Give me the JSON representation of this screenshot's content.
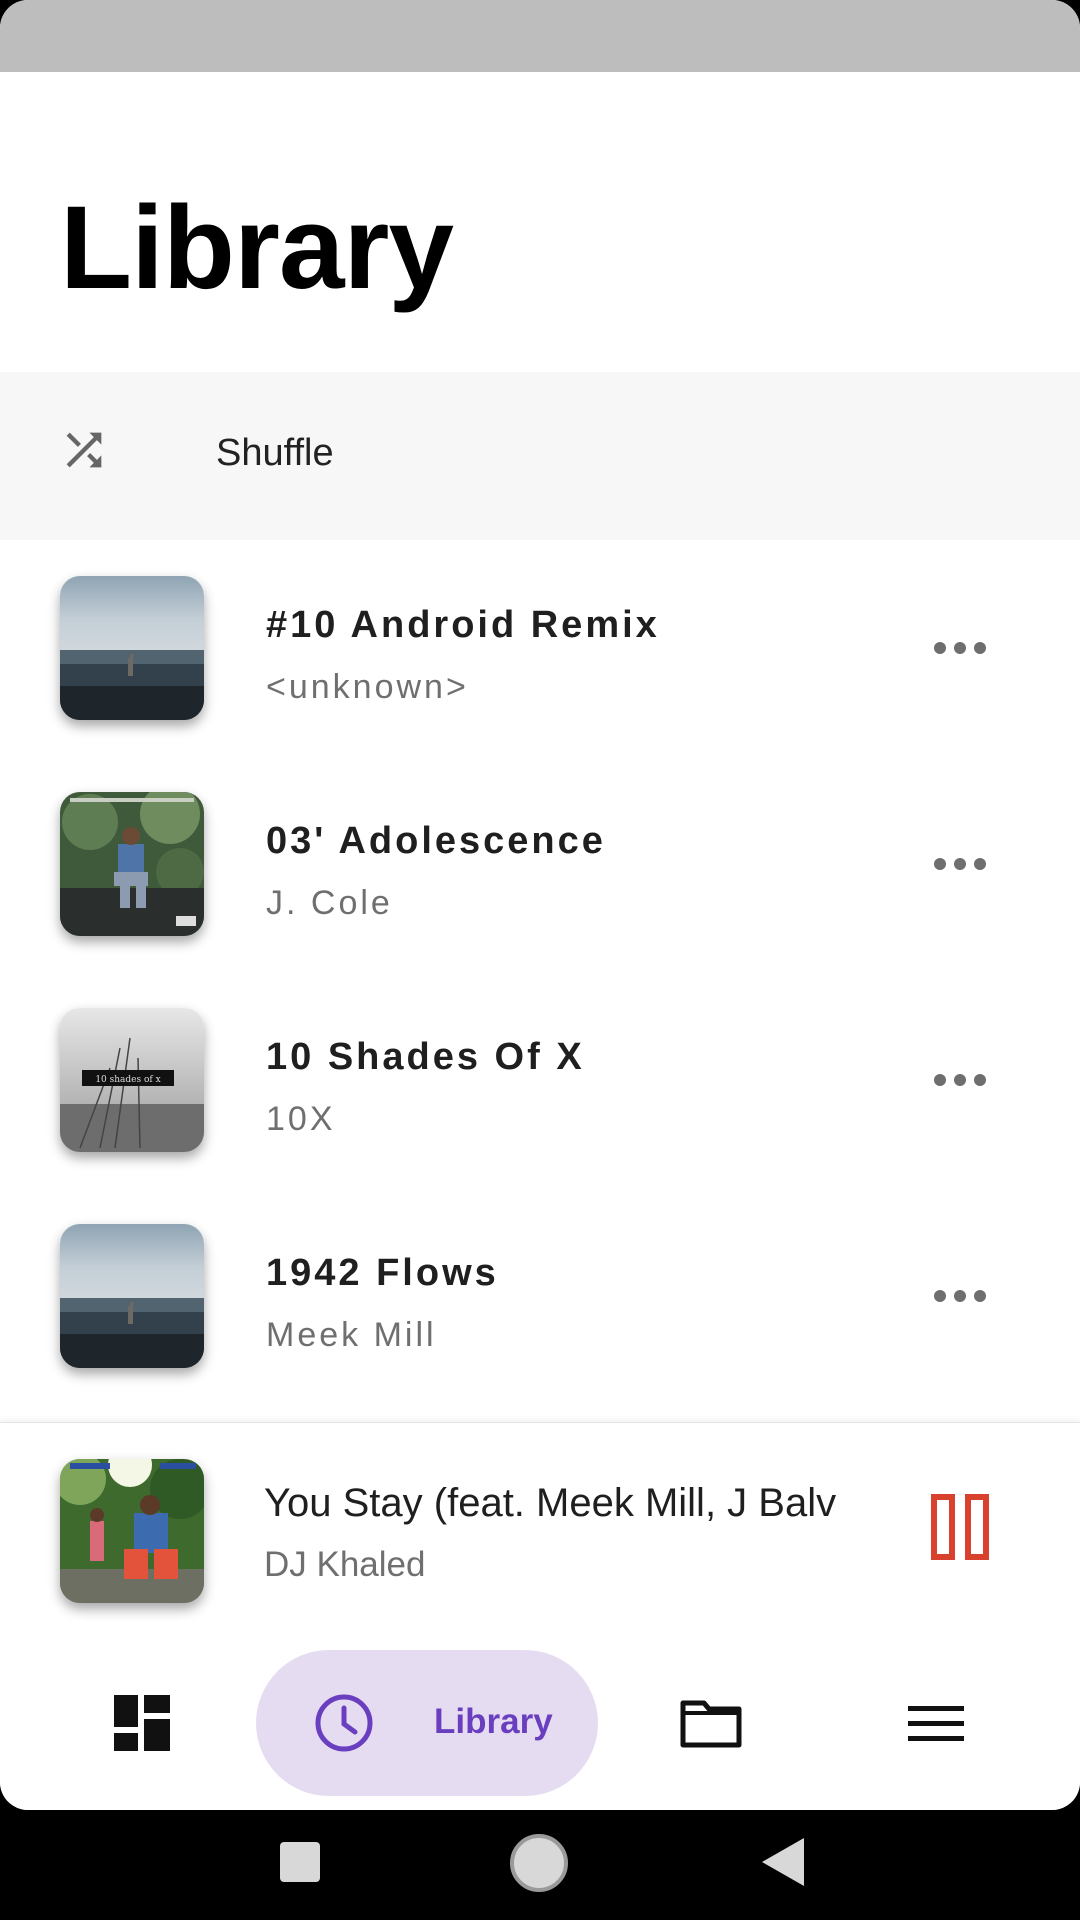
{
  "header": {
    "title": "Library"
  },
  "shuffle": {
    "label": "Shuffle",
    "icon": "shuffle-icon"
  },
  "tracks": [
    {
      "title": "#10 Android Remix",
      "artist": "<unknown>"
    },
    {
      "title": "03' Adolescence",
      "artist": "J. Cole"
    },
    {
      "title": "10 Shades Of X",
      "artist": "10X"
    },
    {
      "title": "1942 Flows",
      "artist": "Meek Mill"
    }
  ],
  "album_art_text": "10 shades of x",
  "now_playing": {
    "title": "You Stay (feat. Meek Mill, J Balv",
    "artist": "DJ Khaled",
    "state_icon": "pause-icon"
  },
  "bottom_nav": {
    "items": [
      {
        "icon": "dashboard-icon"
      },
      {
        "icon": "clock-icon",
        "label": "Library",
        "selected": true
      },
      {
        "icon": "folder-icon"
      },
      {
        "icon": "menu-icon"
      }
    ]
  },
  "colors": {
    "accent": "#6a3fbf",
    "accent_container": "#e6dcf2",
    "pause": "#d9412f",
    "status_bar": "#bdbdbd"
  }
}
